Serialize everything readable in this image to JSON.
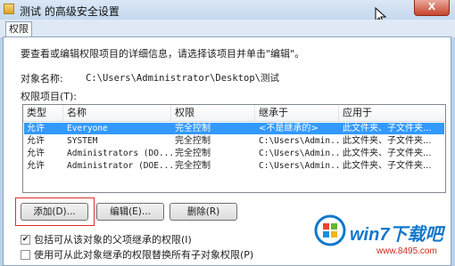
{
  "window": {
    "title": "测试 的高级安全设置",
    "close_label": "X"
  },
  "tabs": [
    {
      "label": "权限"
    }
  ],
  "instruction": "要查看或编辑权限项目的详细信息，请选择该项目并单击\"编辑\"。",
  "object": {
    "label": "对象名称:",
    "value": "C:\\Users\\Administrator\\Desktop\\测试"
  },
  "permissions": {
    "label": "权限项目(T):",
    "columns": [
      "类型",
      "名称",
      "权限",
      "继承于",
      "应用于"
    ],
    "rows": [
      {
        "type": "允许",
        "name": "Everyone",
        "perm": "完全控制",
        "inherit": "<不是继承的>",
        "apply": "此文件夹、子文件夹..."
      },
      {
        "type": "允许",
        "name": "SYSTEM",
        "perm": "完全控制",
        "inherit": "C:\\Users\\Admin...",
        "apply": "此文件夹、子文件夹..."
      },
      {
        "type": "允许",
        "name": "Administrators (DO...",
        "perm": "完全控制",
        "inherit": "C:\\Users\\Admin...",
        "apply": "此文件夹、子文件夹..."
      },
      {
        "type": "允许",
        "name": "Administrator (DOE...",
        "perm": "完全控制",
        "inherit": "C:\\Users\\Admin...",
        "apply": "此文件夹、子文件夹..."
      }
    ],
    "selected_row": 0
  },
  "buttons": {
    "add": "添加(D)...",
    "edit": "编辑(E)...",
    "remove": "删除(R)"
  },
  "checkboxes": [
    {
      "label": "包括可从该对象的父项继承的权限(I)",
      "checked": true
    },
    {
      "label": "使用可从此对象继承的权限替换所有子对象权限(P)",
      "checked": false
    }
  ],
  "watermark": {
    "brand": "win7下载吧",
    "url": "www.8495.com"
  },
  "colors": {
    "selection": "#3399ff",
    "highlight": "#e0302a",
    "brand": "#1177cc"
  }
}
